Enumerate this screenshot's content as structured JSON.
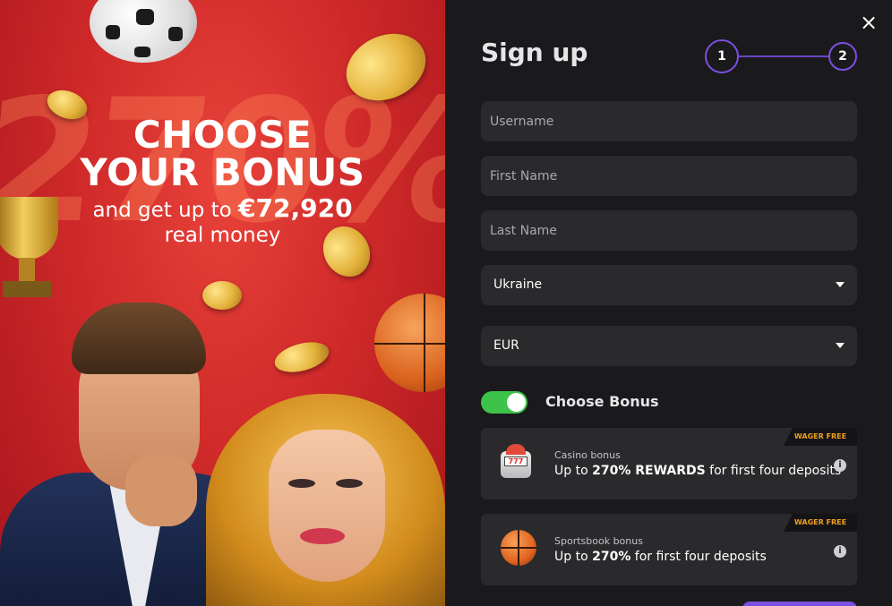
{
  "promo": {
    "title_line1": "CHOOSE",
    "title_line2": "YOUR BONUS",
    "sub_prefix": "and get up to ",
    "sub_amount": "€72,920",
    "sub_line2": "real money",
    "bg_number": "270%"
  },
  "signup": {
    "title": "Sign up",
    "close_icon": "×",
    "steps": [
      "1",
      "2"
    ],
    "fields": {
      "username": {
        "placeholder": "Username",
        "value": ""
      },
      "first_name": {
        "placeholder": "First Name",
        "value": ""
      },
      "last_name": {
        "placeholder": "Last Name",
        "value": ""
      }
    },
    "country": {
      "value": "Ukraine"
    },
    "currency": {
      "value": "EUR"
    },
    "choose_bonus": {
      "label": "Choose Bonus",
      "enabled": true
    },
    "bonuses": [
      {
        "tag": "WAGER FREE",
        "label": "Casino bonus",
        "desc_prefix": "Up to ",
        "desc_bold": "270% REWARDS",
        "desc_suffix": " for first four deposits",
        "icon": "slot-machine-icon"
      },
      {
        "tag": "WAGER FREE",
        "label": "Sportsbook bonus",
        "desc_prefix": "Up to ",
        "desc_bold": "270%",
        "desc_suffix": " for first four deposits",
        "icon": "basketball-icon"
      }
    ],
    "info_icon": "i",
    "slot_reels": "777"
  },
  "colors": {
    "accent": "#7b4fe0",
    "toggle_on": "#3dc34a",
    "tag_text": "#f0a020",
    "panel_bg": "#1a1a1c",
    "field_bg": "#2a2a2d"
  }
}
